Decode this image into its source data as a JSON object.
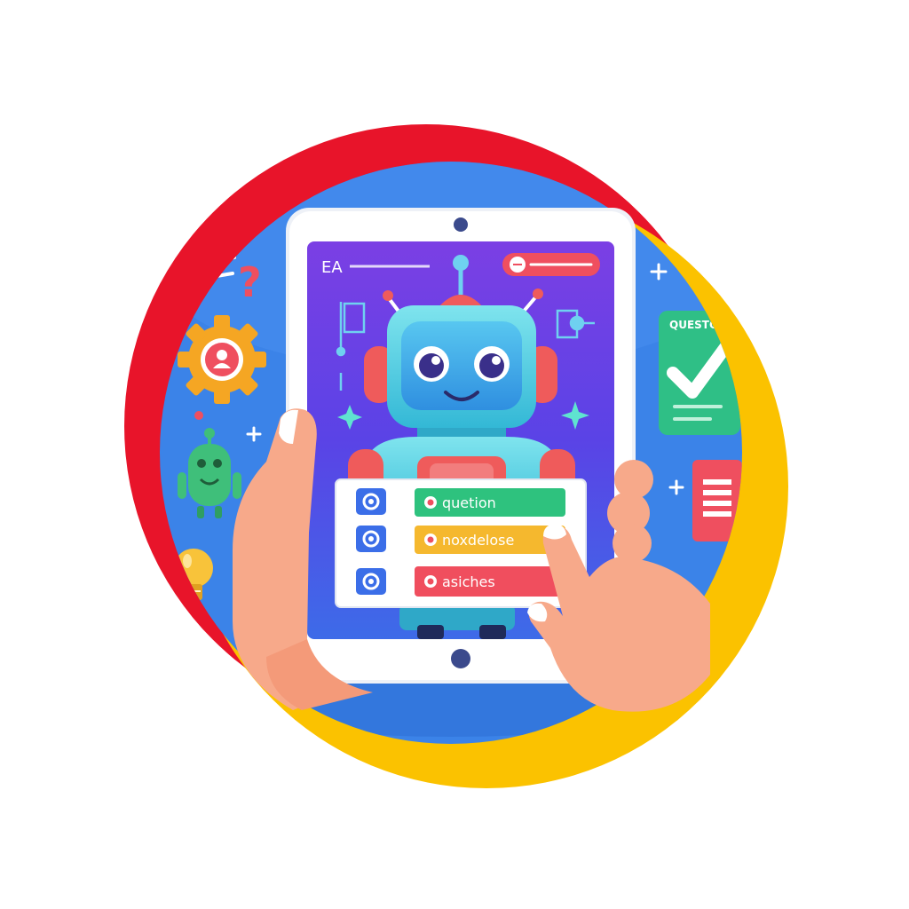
{
  "screen": {
    "header_text": "EA",
    "menu": [
      {
        "label": "quetion",
        "color": "#2ec27e",
        "icon": "radio-icon"
      },
      {
        "label": "noxdelose",
        "color": "#f5b82e",
        "icon": "radio-icon"
      },
      {
        "label": "asiches",
        "color": "#f04e5e",
        "icon": "radio-icon"
      }
    ]
  },
  "side": {
    "card_title": "QUESTO"
  },
  "colors": {
    "ring_red": "#e8142a",
    "ring_yellow": "#fbc200",
    "circle_blue": "#3b83e8",
    "screen_purple": "#6a3de0",
    "robot_teal": "#4ed2e0"
  },
  "icons": [
    "question-mark-icon",
    "gear-user-icon",
    "robot-mascot-icon",
    "lightbulb-icon",
    "checklist-card-icon",
    "document-icon",
    "sparkle-icon",
    "plus-icon"
  ]
}
